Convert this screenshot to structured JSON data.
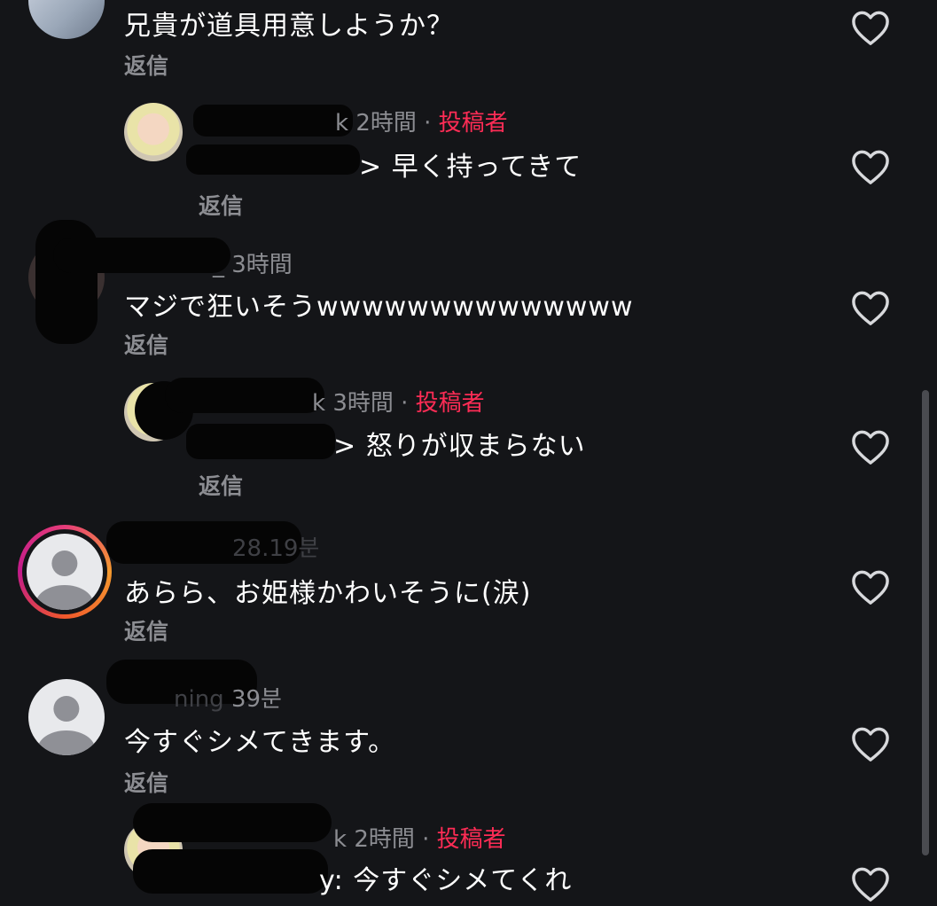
{
  "comments": [
    {
      "username_visible": "",
      "time": "",
      "text": "兄貴が道具用意しようか？",
      "reply_label": "返信"
    },
    {
      "username_visible": "k",
      "time": "2時間",
      "separator": "·",
      "author_tag": "投稿者",
      "mention_suffix": ">",
      "text": "早く持ってきて",
      "reply_label": "返信"
    },
    {
      "username_visible": "_",
      "time": "3時間",
      "text": "マジで狂いそうwwwwwwwwwwwwww",
      "reply_label": "返信"
    },
    {
      "username_visible": "k",
      "time": "3時間",
      "separator": "·",
      "author_tag": "投稿者",
      "mention_suffix": ">",
      "text": "怒りが収まらない",
      "reply_label": "返信"
    },
    {
      "username_visible": "",
      "time": "28.19분",
      "text": "あらら、お姫様かわいそうに(涙)",
      "reply_label": "返信"
    },
    {
      "username_visible": "ning",
      "time": "39분",
      "text": "今すぐシメてきます。",
      "reply_label": "返信"
    },
    {
      "username_visible": "k",
      "time": "2時間",
      "separator": "·",
      "author_tag": "投稿者",
      "mention_suffix": "y:",
      "text": "今すぐシメてくれ",
      "reply_label": ""
    }
  ],
  "icons": {
    "like": "heart-outline-icon",
    "default_avatar": "default-user-icon"
  },
  "colors": {
    "background": "#141518",
    "author_tag": "#fe2c55",
    "meta": "#8c8d92",
    "text": "#ffffff"
  }
}
